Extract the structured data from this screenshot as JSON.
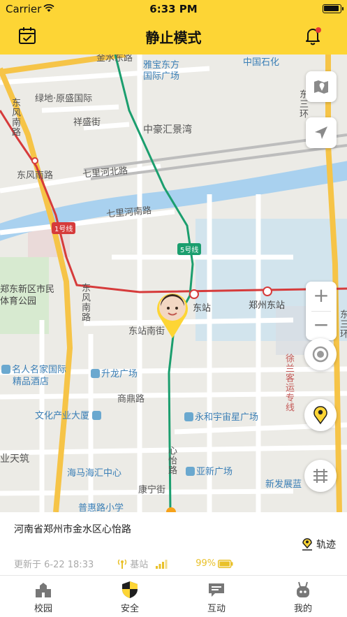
{
  "status_bar": {
    "carrier": "Carrier",
    "time": "6:33 PM",
    "battery_level": 1.0
  },
  "header": {
    "title": "静止模式",
    "left_icon": "calendar-check-icon",
    "right_icon": "bell-icon",
    "notification_dot_color": "#e53935"
  },
  "map": {
    "labels": {
      "jinshui_east": "金水东路",
      "yabao": "雅宝东方",
      "yabao2": "国际广场",
      "sinopec": "中国石化",
      "lvdi": "绿地·原盛国际",
      "xiangsheng": "祥盛街",
      "dongfeng_road_top": "东风南路",
      "zhonghao": "中豪汇景湾",
      "dongsanhuan": "东三环",
      "dongfeng_south": "东风南路",
      "qilihebei": "七里河北路",
      "qilihenan": "七里河南路",
      "line1": "1号线",
      "line5": "5号线",
      "zhengdong_district": "郑东新区市民",
      "sports_park": "体育公园",
      "dongfeng_vertical": "东风南路",
      "east_station_short": "东站",
      "zhengzhou_east": "郑州东站",
      "dongsanhuan_right": "东三环",
      "dongzhannan": "东站南街",
      "celebrity_hotel": "名人名家国际",
      "celebrity_hotel2": "精品酒店",
      "shenglong": "升龙广场",
      "xuzhou_line": "徐兰客运专线",
      "shangding": "商鼎路",
      "culture_tower": "文化产业大厦",
      "yonghe": "永和宇宙星广场",
      "yetianzhu": "业天筑",
      "xinyi_road": "心怡路",
      "haima": "海马海汇中心",
      "asia_new": "亚新广场",
      "xinfazhan": "新发展蓝",
      "kangning": "康宁街",
      "puhui": "普惠路小学"
    },
    "controls": {
      "map_type_icon": "map-icon",
      "locate_icon": "navigation-arrow-icon",
      "zoom_in": "+",
      "zoom_out": "−",
      "center_icon": "target-icon",
      "fence_icon": "location-pin-icon",
      "rail_icon": "railway-icon"
    },
    "colors": {
      "line1": "#d63b3b",
      "line5": "#1b9e6e",
      "road_major": "#f6c447",
      "water": "#a9d1ef"
    }
  },
  "info": {
    "address": "河南省郑州市金水区心怡路",
    "track_label": "轨迹",
    "updated": "更新于 6-22 18:33",
    "positioning": "基站",
    "battery": "99%",
    "battery_level": 0.99
  },
  "tabs": [
    {
      "label": "校园",
      "icon": "school-icon",
      "active": false
    },
    {
      "label": "安全",
      "icon": "shield-icon",
      "active": true
    },
    {
      "label": "互动",
      "icon": "chat-icon",
      "active": false
    },
    {
      "label": "我的",
      "icon": "robot-icon",
      "active": false
    }
  ]
}
